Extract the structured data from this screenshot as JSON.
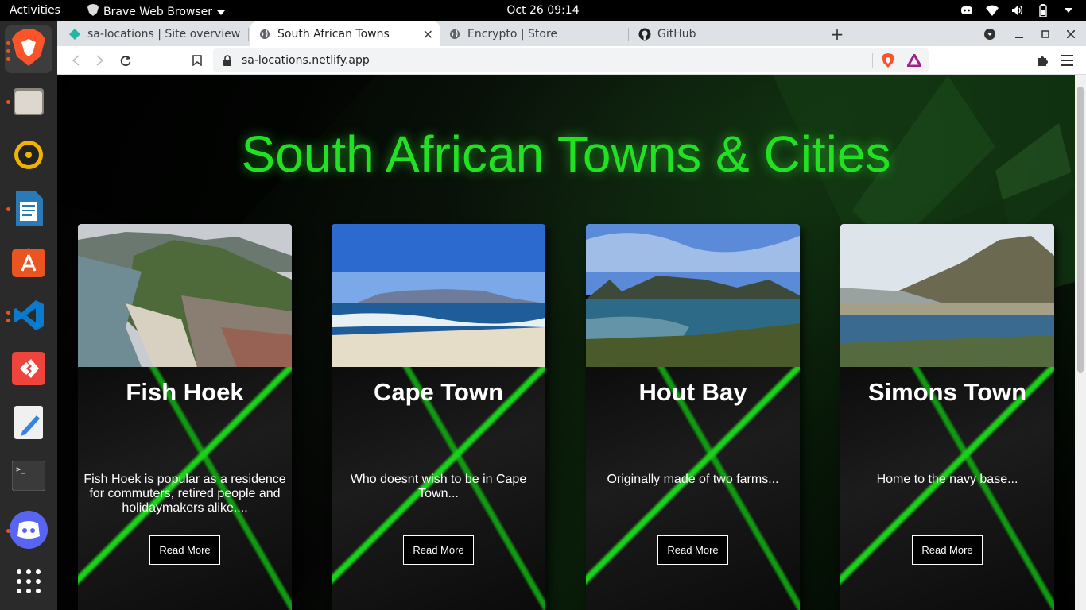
{
  "topbar": {
    "activities": "Activities",
    "app_name": "Brave Web Browser",
    "datetime": "Oct 26  09:14"
  },
  "dock": {
    "items": [
      {
        "name": "brave-browser",
        "color": "#fb542b"
      },
      {
        "name": "files",
        "color": "#c9c4b8"
      },
      {
        "name": "rhythmbox",
        "color": "#f0b400"
      },
      {
        "name": "libreoffice-writer",
        "color": "#2a7ab8"
      },
      {
        "name": "ubuntu-software",
        "color": "#e95420"
      },
      {
        "name": "vscode",
        "color": "#0a7acc"
      },
      {
        "name": "anydesk",
        "color": "#ef443b"
      },
      {
        "name": "text-editor",
        "color": "#f0f0f0"
      },
      {
        "name": "terminal",
        "color": "#3a3a3a"
      },
      {
        "name": "discord",
        "color": "#5865f2"
      },
      {
        "name": "show-applications",
        "color": "#ffffff"
      }
    ]
  },
  "browser": {
    "tabs": [
      {
        "label": "sa-locations | Site overview",
        "active": false
      },
      {
        "label": "South African Towns",
        "active": true
      },
      {
        "label": "Encrypto | Store",
        "active": false
      },
      {
        "label": "GitHub",
        "active": false
      }
    ],
    "url": "sa-locations.netlify.app"
  },
  "page": {
    "title": "South African Towns & Cities",
    "cards": [
      {
        "title": "Fish Hoek",
        "description": "Fish Hoek is popular as a residence for commuters, retired people and holidaymakers alike....",
        "button": "Read More"
      },
      {
        "title": "Cape Town",
        "description": "Who doesnt wish to be in Cape Town...",
        "button": "Read More"
      },
      {
        "title": "Hout Bay",
        "description": "Originally made of two farms...",
        "button": "Read More"
      },
      {
        "title": "Simons Town",
        "description": "Home to the navy base...",
        "button": "Read More"
      }
    ]
  }
}
